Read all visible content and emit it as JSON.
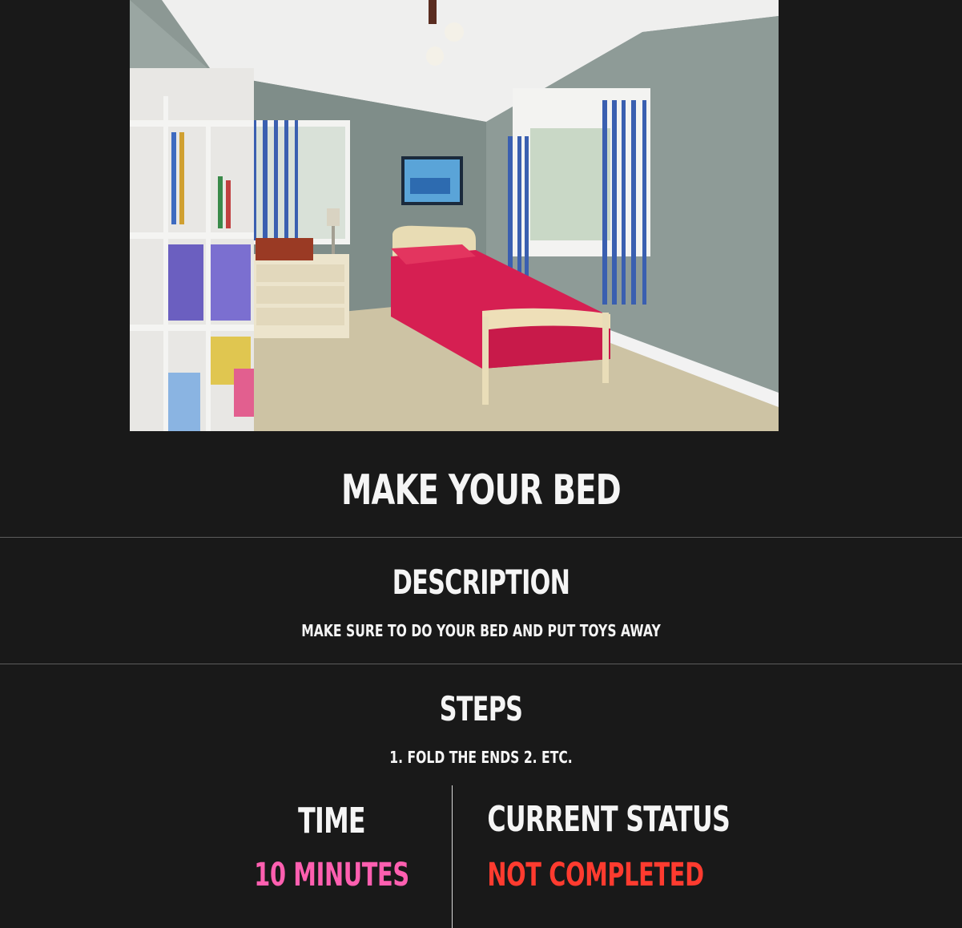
{
  "task": {
    "title": "MAKE YOUR BED"
  },
  "description": {
    "heading": "DESCRIPTION",
    "text": "MAKE SURE TO DO YOUR BED AND PUT TOYS AWAY"
  },
  "steps": {
    "heading": "STEPS",
    "text": "1. FOLD THE ENDS 2. ETC."
  },
  "time": {
    "heading": "TIME",
    "value": "10 MINUTES",
    "color": "#ff5fb0"
  },
  "status": {
    "heading": "CURRENT STATUS",
    "value": "NOT COMPLETED",
    "color": "#ff3b2f"
  },
  "colors": {
    "background": "#191919",
    "text": "#f5f5f5",
    "divider": "#5c5c5c"
  }
}
